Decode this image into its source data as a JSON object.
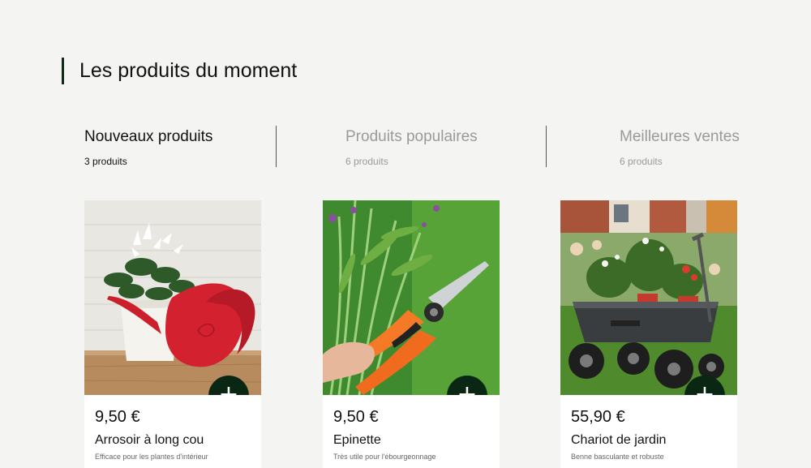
{
  "section": {
    "title": "Les produits du moment"
  },
  "tabs": [
    {
      "title": "Nouveaux produits",
      "count": "3 produits",
      "active": true
    },
    {
      "title": "Produits populaires",
      "count": "6 produits",
      "active": false
    },
    {
      "title": "Meilleures ventes",
      "count": "6 produits",
      "active": false
    }
  ],
  "products": [
    {
      "price": "9,50 €",
      "name": "Arrosoir à long cou",
      "description": "Efficace pour les plantes d'intérieur",
      "image": "red-watering-can-with-cyclamen"
    },
    {
      "price": "9,50 €",
      "name": "Epinette",
      "description": "Très utile pour l'ébourgeonnage",
      "image": "orange-pruning-shears"
    },
    {
      "price": "55,90 €",
      "name": "Chariot de jardin",
      "description": "Benne basculante et robuste",
      "image": "garden-cart-with-plants"
    }
  ],
  "buttons": {
    "add_symbol": "+"
  },
  "colors": {
    "background": "#f4f4f2",
    "accent_dark_green": "#0a2714",
    "inactive_text": "#9a9a9a"
  }
}
